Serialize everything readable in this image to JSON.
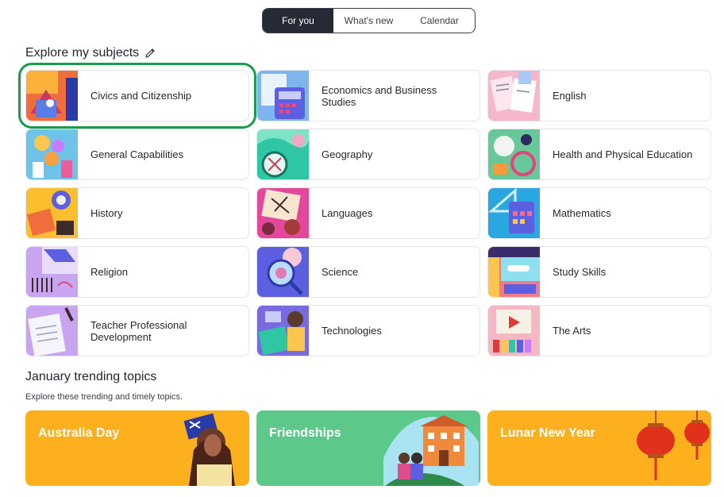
{
  "tabs": [
    {
      "label": "For you",
      "active": true
    },
    {
      "label": "What's new",
      "active": false
    },
    {
      "label": "Calendar",
      "active": false
    }
  ],
  "explore": {
    "title": "Explore my subjects",
    "edit_icon": "pencil-icon"
  },
  "subjects": [
    {
      "label": "Civics and Citizenship",
      "selected": true
    },
    {
      "label": "Economics and Business Studies"
    },
    {
      "label": "English"
    },
    {
      "label": "General Capabilities"
    },
    {
      "label": "Geography"
    },
    {
      "label": "Health and Physical Education"
    },
    {
      "label": "History"
    },
    {
      "label": "Languages"
    },
    {
      "label": "Mathematics"
    },
    {
      "label": "Religion"
    },
    {
      "label": "Science"
    },
    {
      "label": "Study Skills"
    },
    {
      "label": "Teacher Professional Development"
    },
    {
      "label": "Technologies"
    },
    {
      "label": "The Arts"
    }
  ],
  "trending": {
    "title": "January trending topics",
    "subtitle": "Explore these trending and timely topics.",
    "banners": [
      {
        "label": "Australia Day",
        "color": "#fcb01e"
      },
      {
        "label": "Friendships",
        "color": "#5cc98a"
      },
      {
        "label": "Lunar New Year",
        "color": "#fcb01e"
      }
    ]
  },
  "colors": {
    "selected_outline": "#179c4d",
    "active_tab": "#262a35"
  }
}
